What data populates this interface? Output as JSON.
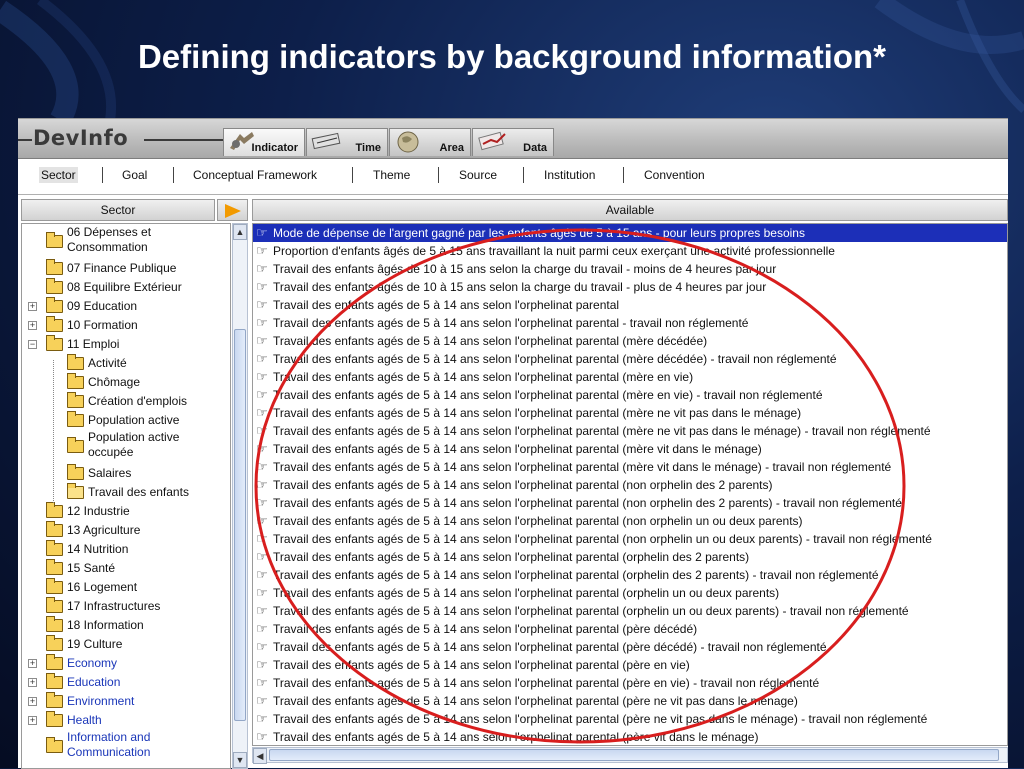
{
  "slide": {
    "title": "Defining indicators by background information*"
  },
  "app": {
    "logo": "DevInfo",
    "top_tabs": [
      {
        "label": "Indicator",
        "icon": "indicator-icon",
        "active": true
      },
      {
        "label": "Time",
        "icon": "time-icon",
        "active": false
      },
      {
        "label": "Area",
        "icon": "area-icon",
        "active": false
      },
      {
        "label": "Data",
        "icon": "data-icon",
        "active": false
      }
    ],
    "sub_tabs": [
      "Sector",
      "Goal",
      "Conceptual Framework",
      "Theme",
      "Source",
      "Institution",
      "Convention"
    ],
    "selected_sub_tab": "Sector"
  },
  "left_panel": {
    "header": "Sector",
    "tree": [
      {
        "label": "06 Dépenses et Consommation",
        "level": 0
      },
      {
        "label": "07 Finance Publique",
        "level": 0
      },
      {
        "label": "08 Equilibre Extérieur",
        "level": 0
      },
      {
        "label": "09 Education",
        "level": 0,
        "expander": "+"
      },
      {
        "label": "10 Formation",
        "level": 0,
        "expander": "+"
      },
      {
        "label": "11 Emploi",
        "level": 0,
        "expander": "−"
      },
      {
        "label": "Activité",
        "level": 1
      },
      {
        "label": "Chômage",
        "level": 1
      },
      {
        "label": "Création d'emplois",
        "level": 1
      },
      {
        "label": "Population active",
        "level": 1
      },
      {
        "label": "Population active occupée",
        "level": 1
      },
      {
        "label": "Salaires",
        "level": 1
      },
      {
        "label": "Travail des enfants",
        "level": 1,
        "open": true
      },
      {
        "label": "12 Industrie",
        "level": 0
      },
      {
        "label": "13 Agriculture",
        "level": 0
      },
      {
        "label": "14 Nutrition",
        "level": 0
      },
      {
        "label": "15 Santé",
        "level": 0
      },
      {
        "label": "16 Logement",
        "level": 0
      },
      {
        "label": "17 Infrastructures",
        "level": 0
      },
      {
        "label": "18 Information",
        "level": 0
      },
      {
        "label": "19 Culture",
        "level": 0
      },
      {
        "label": "Economy",
        "level": 0,
        "expander": "+",
        "blue": true
      },
      {
        "label": "Education",
        "level": 0,
        "expander": "+",
        "blue": true
      },
      {
        "label": "Environment",
        "level": 0,
        "expander": "+",
        "blue": true
      },
      {
        "label": "Health",
        "level": 0,
        "expander": "+",
        "blue": true
      },
      {
        "label": "Information and Communication",
        "level": 0,
        "blue": true
      }
    ]
  },
  "right_panel": {
    "header": "Available",
    "rows": [
      "Mode de dépense de l'argent gagné par les enfants âgés de 5 à 15 ans - pour leurs propres besoins",
      "Proportion d'enfants âgés de 5 à 15 ans travaillant la nuit parmi ceux exerçant une activité professionnelle",
      "Travail des enfants âgés de 10 à 15 ans selon la charge du travail - moins de 4 heures par jour",
      "Travail des enfants âgés de 10 à 15 ans selon la charge du travail - plus de 4 heures par jour",
      "Travail des enfants agés de 5 à 14 ans selon l'orphelinat parental",
      "Travail des enfants agés de 5 à 14 ans selon l'orphelinat parental - travail non réglementé",
      "Travail des enfants agés de 5 à 14 ans selon l'orphelinat parental (mère décédée)",
      "Travail des enfants agés de 5 à 14 ans selon l'orphelinat parental (mère décédée) - travail non réglementé",
      "Travail des enfants agés de 5 à 14 ans selon l'orphelinat parental (mère en vie)",
      "Travail des enfants agés de 5 à 14 ans selon l'orphelinat parental (mère en vie) - travail non réglementé",
      "Travail des enfants agés de 5 à 14 ans selon l'orphelinat parental (mère ne vit pas dans le ménage)",
      "Travail des enfants agés de 5 à 14 ans selon l'orphelinat parental (mère ne vit pas dans le ménage) - travail non réglementé",
      "Travail des enfants agés de 5 à 14 ans selon l'orphelinat parental (mère vit dans le ménage)",
      "Travail des enfants agés de 5 à 14 ans selon l'orphelinat parental (mère vit dans le ménage) - travail non réglementé",
      "Travail des enfants agés de 5 à 14 ans selon l'orphelinat parental (non orphelin des 2 parents)",
      "Travail des enfants agés de 5 à 14 ans selon l'orphelinat parental (non orphelin des 2 parents) - travail non réglementé",
      "Travail des enfants agés de 5 à 14 ans selon l'orphelinat parental (non orphelin un ou deux parents)",
      "Travail des enfants agés de 5 à 14 ans selon l'orphelinat parental (non orphelin un ou deux parents) - travail non réglementé",
      "Travail des enfants agés de 5 à 14 ans selon l'orphelinat parental (orphelin des 2 parents)",
      "Travail des enfants agés de 5 à 14 ans selon l'orphelinat parental (orphelin des 2 parents) - travail non réglementé",
      "Travail des enfants agés de 5 à 14 ans selon l'orphelinat parental (orphelin un ou deux parents)",
      "Travail des enfants agés de 5 à 14 ans selon l'orphelinat parental (orphelin un ou deux parents) - travail non réglementé",
      "Travail des enfants agés de 5 à 14 ans selon l'orphelinat parental (père décédé)",
      "Travail des enfants agés de 5 à 14 ans selon l'orphelinat parental (père décédé) - travail non réglementé",
      "Travail des enfants agés de 5 à 14 ans selon l'orphelinat parental (père en vie)",
      "Travail des enfants agés de 5 à 14 ans selon l'orphelinat parental (père en vie) - travail non réglementé",
      "Travail des enfants agés de 5 à 14 ans selon l'orphelinat parental (père ne vit pas dans le ménage)",
      "Travail des enfants agés de 5 à 14 ans selon l'orphelinat parental (père ne vit pas dans le ménage) - travail non réglementé",
      "Travail des enfants agés de 5 à 14 ans selon l'orphelinat parental (père vit dans le ménage)"
    ],
    "selected_row": 0
  },
  "colors": {
    "selection": "#1c2fb8",
    "annotation_circle": "#d81e1e",
    "arrow": "#f29a00"
  }
}
